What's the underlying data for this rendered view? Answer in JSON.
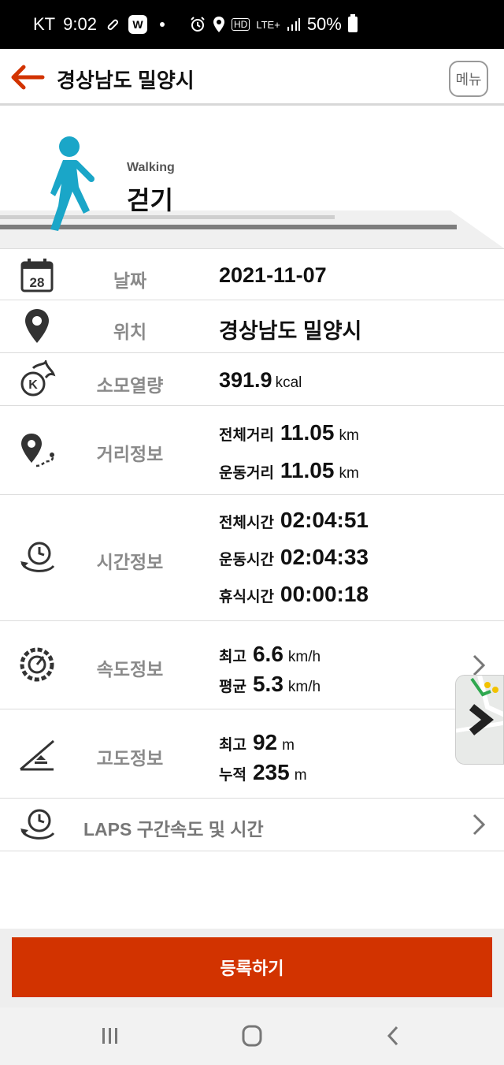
{
  "status_bar": {
    "carrier": "KT",
    "time": "9:02",
    "w_badge": "W",
    "hd": "HD",
    "network": "LTE+",
    "battery": "50%"
  },
  "header": {
    "title": "경상남도 밀양시",
    "menu_label": "메뉴"
  },
  "activity": {
    "english": "Walking",
    "korean": "걷기"
  },
  "rows": {
    "date": {
      "label": "날짜",
      "value": "2021-11-07"
    },
    "location": {
      "label": "위치",
      "value": "경상남도 밀양시"
    },
    "calories": {
      "label": "소모열량",
      "value": "391.9",
      "unit": "kcal"
    },
    "distance": {
      "label": "거리정보",
      "total_key": "전체거리",
      "total_value": "11.05",
      "total_unit": "km",
      "exercise_key": "운동거리",
      "exercise_value": "11.05",
      "exercise_unit": "km"
    },
    "time": {
      "label": "시간정보",
      "total_key": "전체시간",
      "total_value": "02:04:51",
      "exercise_key": "운동시간",
      "exercise_value": "02:04:33",
      "rest_key": "휴식시간",
      "rest_value": "00:00:18"
    },
    "speed": {
      "label": "속도정보",
      "max_key": "최고",
      "max_value": "6.6",
      "max_unit": "km/h",
      "avg_key": "평균",
      "avg_value": "5.3",
      "avg_unit": "km/h"
    },
    "altitude": {
      "label": "고도정보",
      "max_key": "최고",
      "max_value": "92",
      "max_unit": "m",
      "cum_key": "누적",
      "cum_value": "235",
      "cum_unit": "m"
    },
    "laps": {
      "label": "LAPS 구간속도 및 시간"
    }
  },
  "calendar_day": "28",
  "register_button": "등록하기",
  "colors": {
    "accent": "#d23300",
    "walker": "#1aa6c8",
    "label_gray": "#8a8a8a"
  },
  "icons": [
    "back-arrow-icon",
    "calendar-icon",
    "location-pin-icon",
    "calorie-icon",
    "distance-icon",
    "time-icon",
    "speedometer-icon",
    "altitude-icon",
    "laps-icon",
    "chevron-right-icon"
  ]
}
